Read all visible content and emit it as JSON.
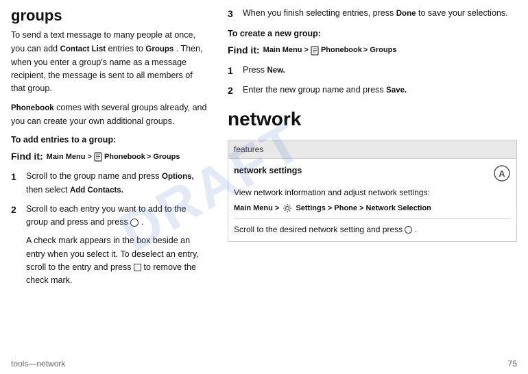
{
  "left": {
    "section_title": "groups",
    "intro_para": "To send a text message to many people at once, you can add",
    "contact_list": "Contact List",
    "intro_para2": "entries to",
    "groups_word": "Groups",
    "intro_para3": ". Then, when you enter a group's name as a message recipient, the message is sent to all members of that group.",
    "phonebook_word": "Phonebook",
    "second_para": "comes with several groups already, and you can create your own additional groups.",
    "add_entries_heading": "To add entries to a group:",
    "find_it_label": "Find it:",
    "find_it_path": "Main Menu >",
    "find_it_phonebook": "Phonebook",
    "find_it_groups": "> Groups",
    "step1_num": "1",
    "step1_text": "Scroll to the group name and press",
    "step1_options": "Options,",
    "step1_text2": "then select",
    "step1_add_contacts": "Add Contacts.",
    "step2_num": "2",
    "step2_text": "Scroll to each entry you want to add to the group and press",
    "step2_bullet": "●",
    "step2_text2": ".",
    "step3_text": "A check mark appears in the box beside an entry when you select it. To deselect an entry, scroll to the entry and press",
    "step3_button": "◻",
    "step3_text2": "to remove the check mark."
  },
  "right": {
    "step3_num": "3",
    "step3_intro": "When you finish selecting entries, press",
    "step3_done": "Done",
    "step3_end": "to save your selections.",
    "new_group_heading": "To create a new group:",
    "find_it_label": "Find it:",
    "find_it_path": "Main Menu >",
    "find_it_phonebook": "Phonebook",
    "find_it_groups": "> Groups",
    "step1_num": "1",
    "step1_text": "Press",
    "step1_new": "New.",
    "step2_num": "2",
    "step2_text": "Enter the new group name and press",
    "step2_save": "Save.",
    "network_title": "network",
    "features_header": "features",
    "network_settings_label": "network settings",
    "network_desc1": "View network information and adjust network settings:",
    "network_menu_path": "Main Menu >",
    "network_settings_word": "Settings",
    "network_phone": "> Phone >",
    "network_selection": "Network Selection",
    "network_scroll": "Scroll to the desired network setting and press",
    "network_bullet": "●",
    "network_scroll_end": "."
  },
  "footer": {
    "page_label": "tools—network",
    "page_number": "75"
  }
}
